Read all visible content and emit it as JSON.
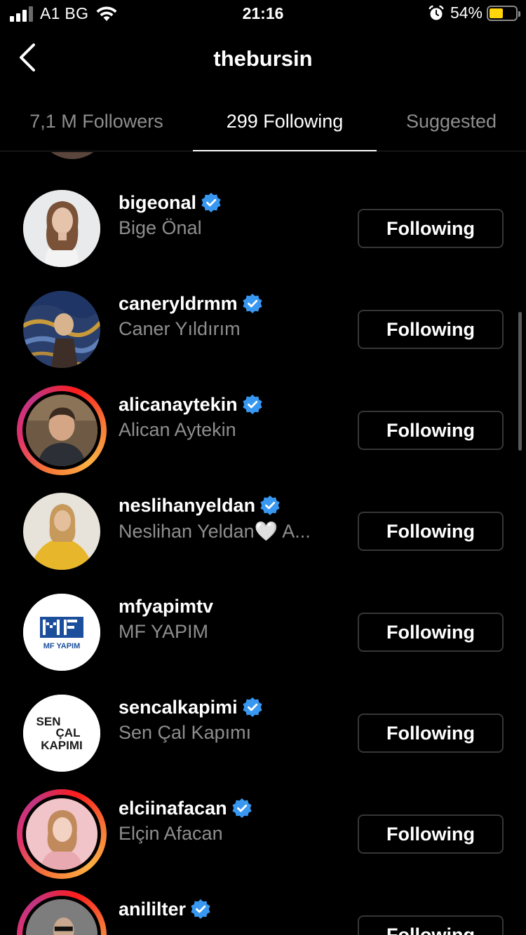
{
  "status_bar": {
    "carrier": "A1 BG",
    "time": "21:16",
    "battery_percent": "54%",
    "battery_level": 0.54,
    "battery_color": "#ffd60a"
  },
  "header": {
    "title": "thebursin",
    "back_icon": "chevron-left-icon"
  },
  "tabs": [
    {
      "label": "7,1 M Followers",
      "active": false
    },
    {
      "label": "299 Following",
      "active": true
    },
    {
      "label": "Suggested",
      "active": false
    }
  ],
  "users": [
    {
      "username": "bigeonal",
      "full_name": "Bige Önal",
      "verified": true,
      "story_ring": false,
      "button": "Following"
    },
    {
      "username": "caneryldrmm",
      "full_name": "Caner Yıldırım",
      "verified": true,
      "story_ring": false,
      "button": "Following"
    },
    {
      "username": "alicanaytekin",
      "full_name": "Alican Aytekin",
      "verified": true,
      "story_ring": true,
      "button": "Following"
    },
    {
      "username": "neslihanyeldan",
      "full_name": "Neslihan Yeldan🤍 A...",
      "verified": true,
      "story_ring": false,
      "button": "Following"
    },
    {
      "username": "mfyapimtv",
      "full_name": "MF YAPIM",
      "verified": false,
      "story_ring": false,
      "button": "Following",
      "logo_text": "MF YAPIM"
    },
    {
      "username": "sencalkapimi",
      "full_name": "Sen Çal Kapımı",
      "verified": true,
      "story_ring": false,
      "button": "Following",
      "logo_lines": [
        "SEN",
        "ÇAL",
        "KAPIMI"
      ]
    },
    {
      "username": "elciinafacan",
      "full_name": "Elçin Afacan",
      "verified": true,
      "story_ring": true,
      "button": "Following"
    },
    {
      "username": "anililter",
      "full_name": "",
      "verified": true,
      "story_ring": true,
      "button": "Following"
    }
  ],
  "colors": {
    "background": "#000000",
    "verified_badge": "#3897f0",
    "secondary_text": "#8e8e8e",
    "button_border": "#363636"
  }
}
